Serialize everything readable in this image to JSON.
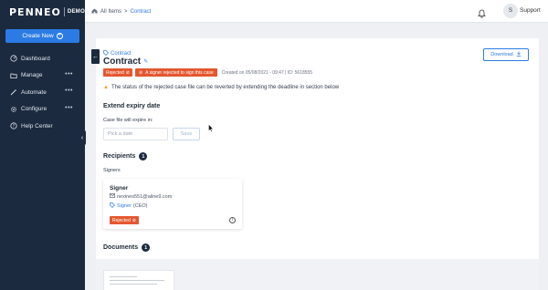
{
  "sidebar": {
    "logo": "PENNEO",
    "logo_tag": "DEMO",
    "create_label": "Create New",
    "items": [
      {
        "label": "Dashboard",
        "icon": "dashboard-icon",
        "has_more": false
      },
      {
        "label": "Manage",
        "icon": "folder-icon",
        "has_more": true
      },
      {
        "label": "Automate",
        "icon": "wand-icon",
        "has_more": true
      },
      {
        "label": "Configure",
        "icon": "gear-icon",
        "has_more": true
      },
      {
        "label": "Help Center",
        "icon": "help-icon",
        "has_more": false
      }
    ]
  },
  "topbar": {
    "breadcrumb_root": "All Items",
    "breadcrumb_sep": ">",
    "breadcrumb_current": "Contract",
    "avatar_initial": "S",
    "user_label": "Support"
  },
  "case": {
    "folder": "Contract",
    "title": "Contract",
    "download_label": "Download",
    "status_badge": "Rejected",
    "status_message": "A signer rejected to sign this case",
    "created_info": "Created on 05/08/2021 - 09:47  |  ID: 5618555",
    "warning": "The status of the rejected case file can be reverted by extending the deadline in section below"
  },
  "expiry": {
    "title": "Extend expiry date",
    "label": "Case file will expire in:",
    "placeholder": "Pick a date",
    "save_label": "Save"
  },
  "recipients": {
    "title": "Recipients",
    "count": "1",
    "group_label": "Signers",
    "signer": {
      "name": "Signer",
      "email": "nexines551@aline9.com",
      "role": "Signer",
      "role_detail": "(CEO)",
      "status": "Rejected"
    }
  },
  "documents": {
    "title": "Documents",
    "count": "1"
  },
  "colors": {
    "sidebar_bg": "#1b2a3e",
    "accent": "#2c7be5",
    "rejected": "#e4572e",
    "warning": "#f0a020"
  }
}
